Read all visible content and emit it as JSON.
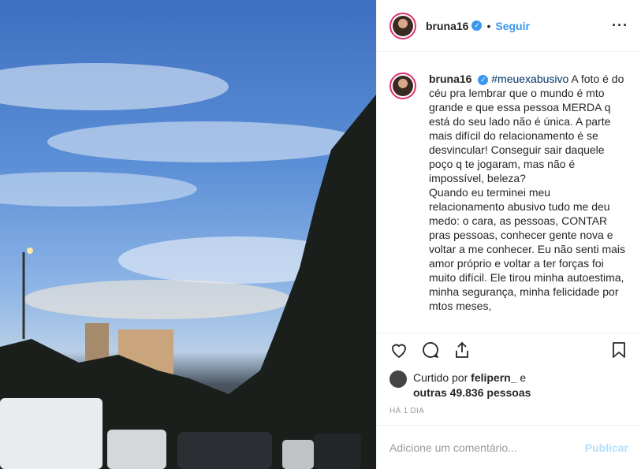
{
  "post": {
    "username": "bruna16",
    "follow_label": "Seguir",
    "hashtag": "#meuexabusivo",
    "caption": " A foto é do céu pra lembrar que o mundo é mto grande e que essa pessoa MERDA q está do seu lado não é única. A parte mais difícil do relacionamento é se desvincular! Conseguir sair daquele poço q te jogaram, mas não é impossível, beleza?\nQuando eu terminei meu relacionamento abusivo tudo me deu medo: o cara, as pessoas, CONTAR pras pessoas, conhecer gente nova e voltar a me conhecer. Eu não senti mais amor próprio e voltar a ter forças foi muito difícil. Ele tirou minha autoestima, minha segurança, minha felicidade por mtos meses,",
    "liked_prefix": "Curtido por ",
    "liked_user": "felipern_",
    "liked_and": " e",
    "liked_others": "outras 49.836 pessoas",
    "time_ago": "HÁ 1 DIA"
  },
  "comment": {
    "placeholder": "Adicione um comentário...",
    "publish_label": "Publicar"
  },
  "colors": {
    "accent": "#3897f0",
    "publish_disabled": "#b2dffc"
  }
}
